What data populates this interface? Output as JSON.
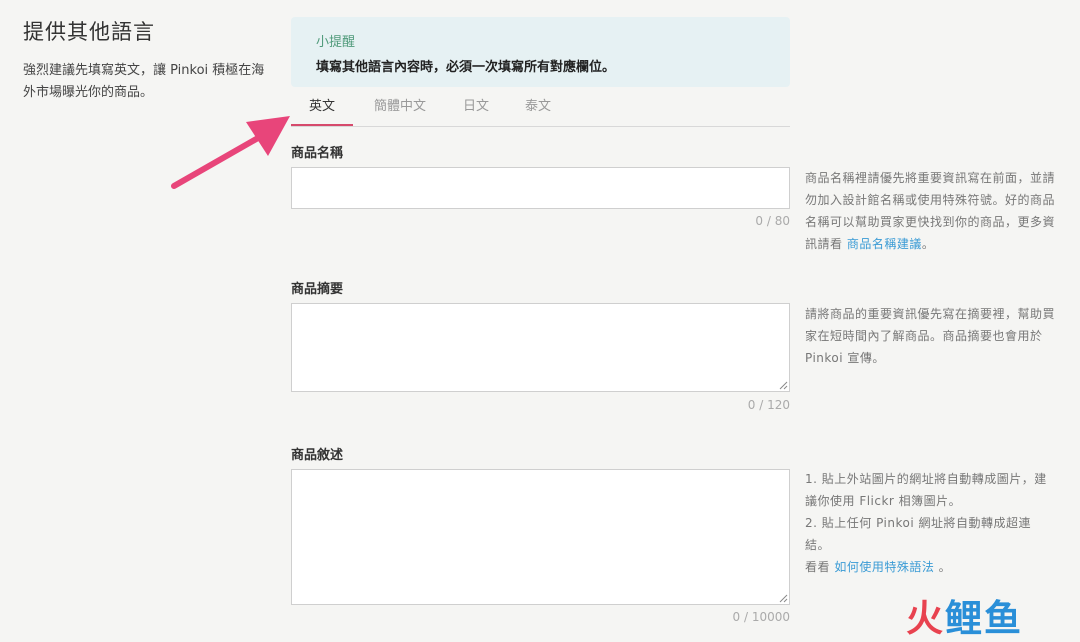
{
  "section": {
    "title": "提供其他語言",
    "description": "強烈建議先填寫英文，讓 Pinkoi 積極在海外市場曝光你的商品。"
  },
  "tip": {
    "title": "小提醒",
    "body": "填寫其他語言內容時，必須一次填寫所有對應欄位。"
  },
  "tabs": [
    {
      "label": "英文",
      "active": true
    },
    {
      "label": "簡體中文",
      "active": false
    },
    {
      "label": "日文",
      "active": false
    },
    {
      "label": "泰文",
      "active": false
    }
  ],
  "fields": {
    "name": {
      "label": "商品名稱",
      "value": "",
      "counter": "0 / 80",
      "help_text": "商品名稱裡請優先將重要資訊寫在前面，並請勿加入設計館名稱或使用特殊符號。好的商品名稱可以幫助買家更快找到你的商品，更多資訊請看 ",
      "help_link": "商品名稱建議",
      "help_suffix": "。"
    },
    "summary": {
      "label": "商品摘要",
      "value": "",
      "counter": "0 / 120",
      "help_text": "請將商品的重要資訊優先寫在摘要裡，幫助買家在短時間內了解商品。商品摘要也會用於 Pinkoi 宣傳。"
    },
    "description": {
      "label": "商品敘述",
      "value": "",
      "counter": "0 / 10000",
      "help_line1": "1. 貼上外站圖片的網址將自動轉成圖片，建議你使用 Flickr 相簿圖片。",
      "help_line2": "2. 貼上任何 Pinkoi 網址將自動轉成超連結。",
      "help_prefix": "看看 ",
      "help_link": "如何使用特殊語法",
      "help_suffix": " 。"
    }
  },
  "watermark": {
    "part1": "火",
    "part2": "鲤鱼"
  },
  "colors": {
    "accent_tab": "#d64a6c",
    "arrow": "#e8457a",
    "link": "#3a9bd5",
    "tip_background": "#e6f1f3",
    "tip_title": "#4f9a7a"
  },
  "icons": {
    "annotation": "arrow-icon",
    "resize": "resize-handle-icon"
  }
}
